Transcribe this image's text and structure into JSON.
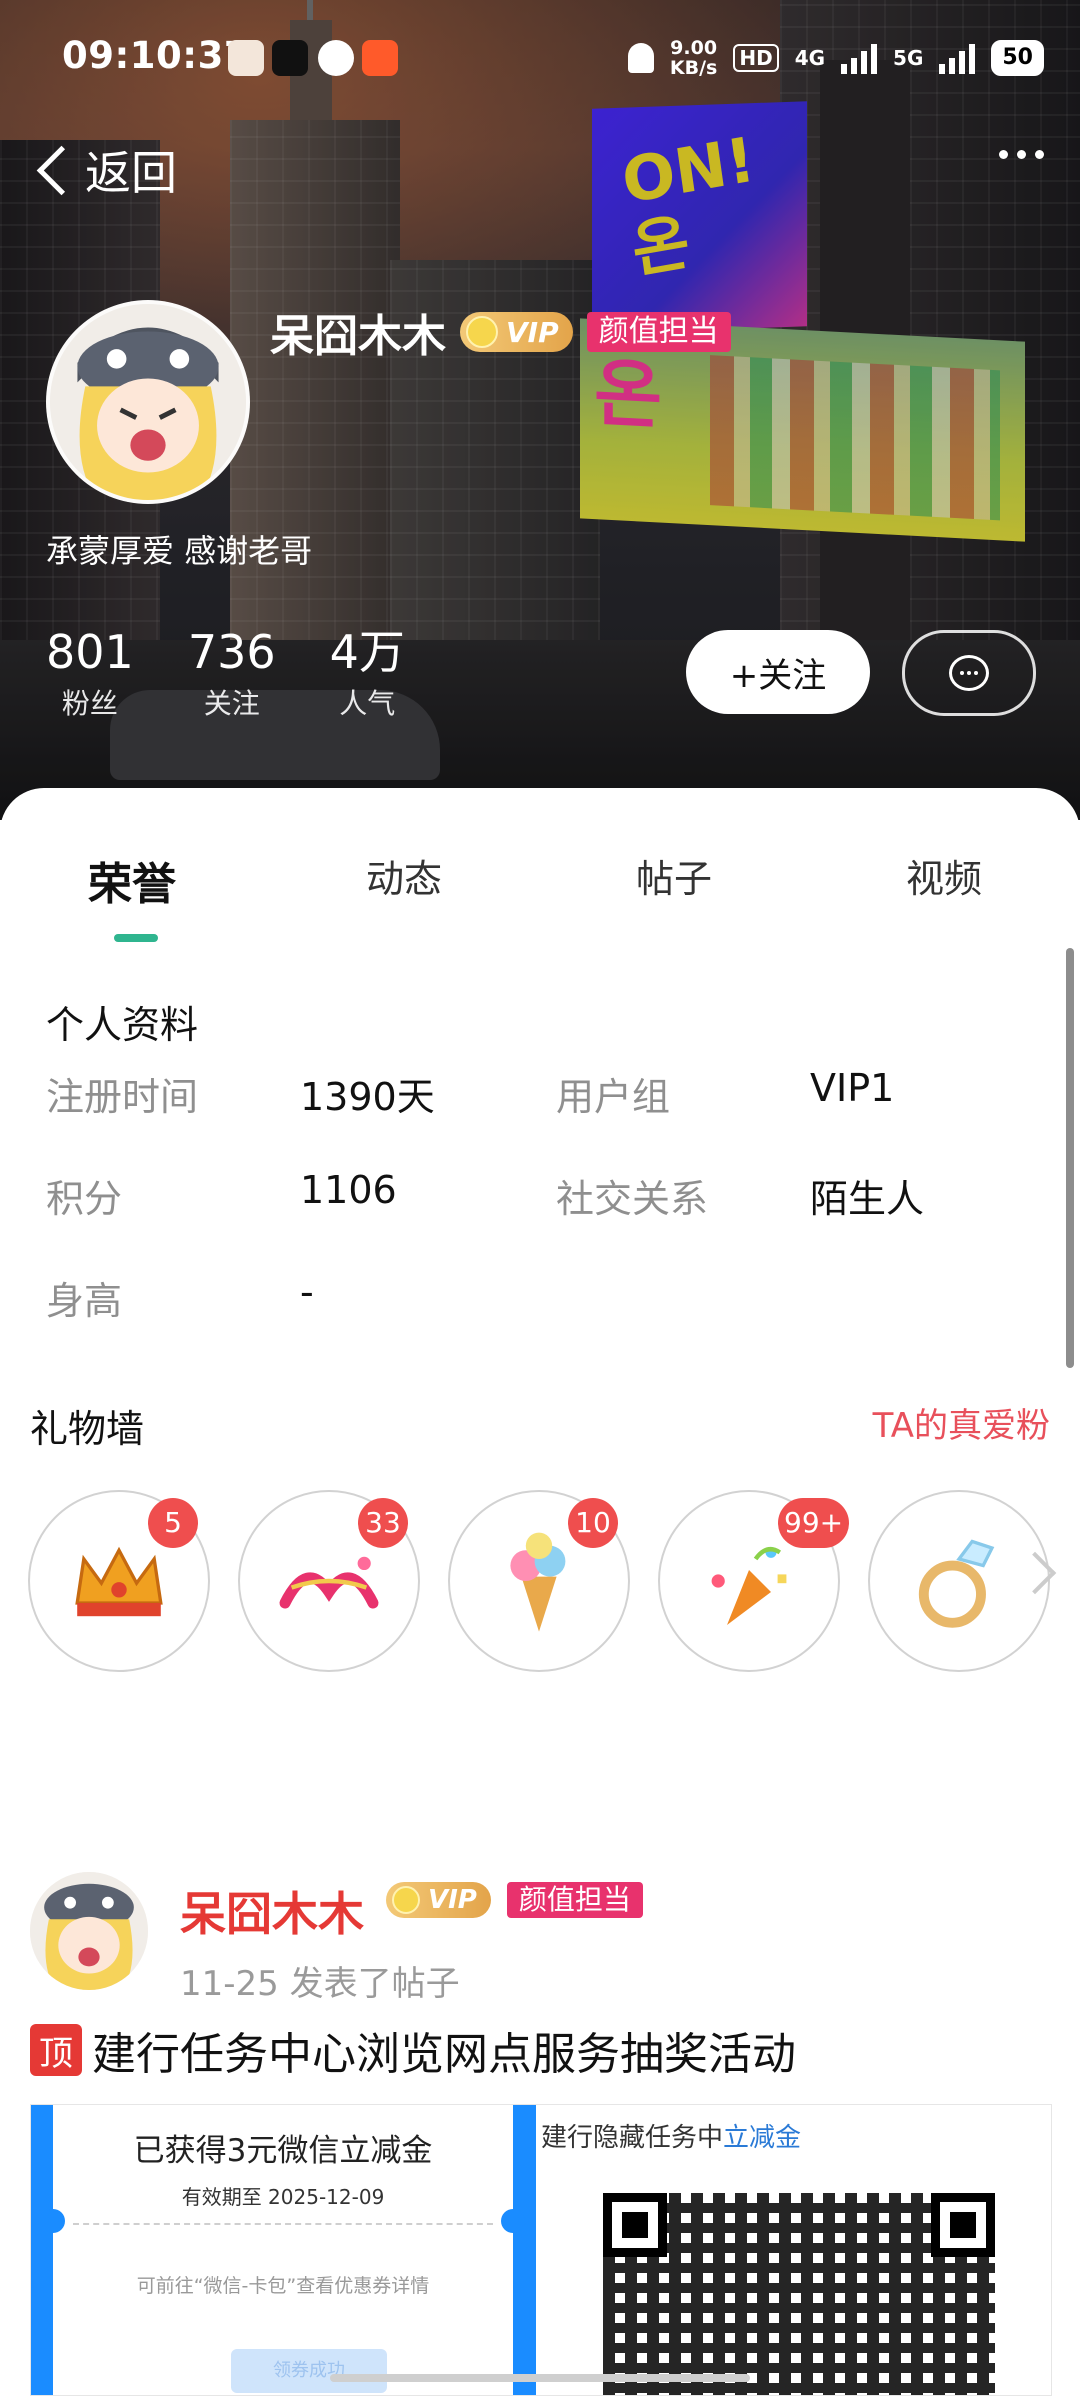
{
  "status_bar": {
    "time": "09:10:37",
    "speed_value": "9.00",
    "speed_unit": "KB/s",
    "hd_label": "HD",
    "network_4g": "4G",
    "network_5g": "5G",
    "battery": "50",
    "app_icons": [
      "avatar-app-icon",
      "tiktok-icon",
      "chat-app-icon",
      "game-app-icon"
    ]
  },
  "header": {
    "back_label": "返回"
  },
  "profile": {
    "username": "呆囧木木",
    "vip_label": "VIP",
    "title_badge": "颜值担当",
    "signature": "承蒙厚爱 感谢老哥",
    "stats": [
      {
        "value": "801",
        "label": "粉丝"
      },
      {
        "value": "736",
        "label": "关注"
      },
      {
        "value": "4万",
        "label": "人气"
      }
    ],
    "follow_label": "+关注"
  },
  "tabs": [
    {
      "label": "荣誉",
      "active": true
    },
    {
      "label": "动态",
      "active": false
    },
    {
      "label": "帖子",
      "active": false
    },
    {
      "label": "视频",
      "active": false
    }
  ],
  "personal_info": {
    "title": "个人资料",
    "fields": [
      {
        "label": "注册时间",
        "value": "1390天"
      },
      {
        "label": "用户组",
        "value": "VIP1"
      },
      {
        "label": "积分",
        "value": "1106"
      },
      {
        "label": "社交关系",
        "value": "陌生人"
      },
      {
        "label": "身高",
        "value": "-"
      }
    ]
  },
  "gift_wall": {
    "title": "礼物墙",
    "fans_link": "TA的真爱粉",
    "gifts": [
      {
        "icon": "crown-icon",
        "count": "5"
      },
      {
        "icon": "kiss-text-icon",
        "count": "33"
      },
      {
        "icon": "ice-cream-icon",
        "count": "10"
      },
      {
        "icon": "party-popper-icon",
        "count": "99+"
      },
      {
        "icon": "ring-icon",
        "count": ""
      }
    ]
  },
  "post": {
    "author": "呆囧木木",
    "vip_label": "VIP",
    "title_badge": "颜值担当",
    "date": "11-25",
    "action": "发表了帖子",
    "pin_label": "顶",
    "title": "建行任务中心浏览网点服务抽奖活动",
    "image": {
      "coupon_title": "已获得3元微信立减金",
      "coupon_expire": "有效期至 2025-12-09",
      "coupon_hint": "可前往“微信-卡包”查看优惠券详情",
      "coupon_button": "领券成功",
      "qr_text_prefix": "建行隐藏任务中",
      "qr_text_highlight": "立减金"
    }
  },
  "colors": {
    "accent_green": "#2fb58f",
    "vip_gold": "#e3a44a",
    "badge_pink": "#e8326d",
    "gift_count_red": "#ef4e4e",
    "author_red": "#e53935",
    "fans_link_red": "#e8505b"
  }
}
